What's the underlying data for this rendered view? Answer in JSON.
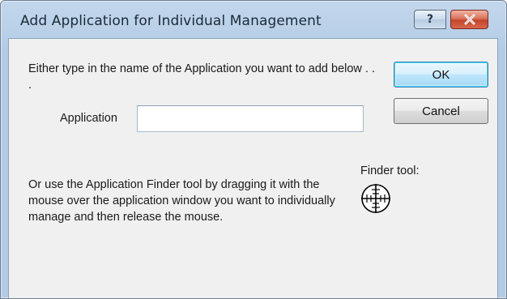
{
  "window": {
    "title": "Add Application for Individual Management",
    "help_glyph": "?",
    "close_glyph": "x"
  },
  "intro_text": "Either type in the name of the Application you want to add below . . .",
  "application": {
    "label": "Application",
    "value": "",
    "placeholder": ""
  },
  "buttons": {
    "ok": "OK",
    "cancel": "Cancel"
  },
  "finder": {
    "label": "Finder tool:",
    "icon": "crosshair-icon",
    "instructions": "Or use the Application Finder tool by dragging it with the mouse over the application window you want to individually manage and then release the mouse."
  },
  "colors": {
    "close_button": "#c4452b",
    "ok_focus_border": "#3c7fb1",
    "client_background": "#f0f0f0"
  }
}
